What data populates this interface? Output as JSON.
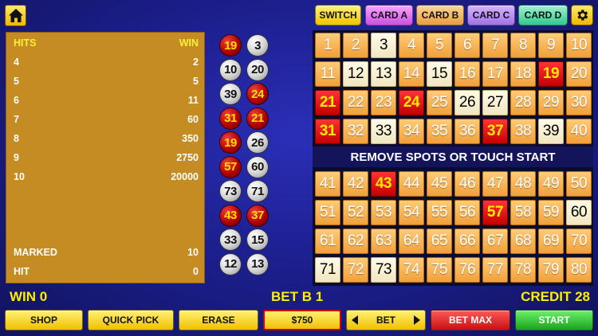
{
  "colors": {
    "background": "#1c1f8e",
    "paytable": "#c48c22",
    "highlight_text": "#ffee00",
    "number_cell": "#f0a03a",
    "marked_cell": "#fffbe7",
    "hit_cell": "#c40000"
  },
  "icons": {
    "home": "home-icon",
    "settings": "gear-icon"
  },
  "toolbar": {
    "switch_label": "SWITCH",
    "card_a": "CARD A",
    "card_b": "CARD B",
    "card_c": "CARD C",
    "card_d": "CARD D"
  },
  "paytable": {
    "hits_header": "HITS",
    "win_header": "WIN",
    "rows": [
      {
        "hits": "4",
        "win": "2"
      },
      {
        "hits": "5",
        "win": "5"
      },
      {
        "hits": "6",
        "win": "11"
      },
      {
        "hits": "7",
        "win": "60"
      },
      {
        "hits": "8",
        "win": "350"
      },
      {
        "hits": "9",
        "win": "2750"
      },
      {
        "hits": "10",
        "win": "20000"
      }
    ],
    "marked_label": "MARKED",
    "marked_value": "10",
    "hit_label": "HIT",
    "hit_value": "0"
  },
  "drawn_balls": [
    {
      "n": "19",
      "hit": true
    },
    {
      "n": "3",
      "hit": false
    },
    {
      "n": "10",
      "hit": false
    },
    {
      "n": "20",
      "hit": false
    },
    {
      "n": "39",
      "hit": false
    },
    {
      "n": "24",
      "hit": true
    },
    {
      "n": "31",
      "hit": true
    },
    {
      "n": "21",
      "hit": true
    },
    {
      "n": "19",
      "hit": true
    },
    {
      "n": "26",
      "hit": false
    },
    {
      "n": "57",
      "hit": true
    },
    {
      "n": "60",
      "hit": false
    },
    {
      "n": "73",
      "hit": false
    },
    {
      "n": "71",
      "hit": false
    },
    {
      "n": "43",
      "hit": true
    },
    {
      "n": "37",
      "hit": true
    },
    {
      "n": "33",
      "hit": false
    },
    {
      "n": "15",
      "hit": false
    },
    {
      "n": "12",
      "hit": false
    },
    {
      "n": "13",
      "hit": false
    }
  ],
  "board": {
    "message": "REMOVE SPOTS OR TOUCH START",
    "marked": [
      3,
      12,
      13,
      15,
      26,
      27,
      33,
      39,
      60,
      71,
      73
    ],
    "hits": [
      19,
      21,
      24,
      31,
      37,
      43,
      57
    ]
  },
  "status": {
    "win": "WIN 0",
    "bet": "BET B 1",
    "credit": "CREDIT 28"
  },
  "controls": {
    "shop": "SHOP",
    "quick_pick": "QUICK PICK",
    "erase": "ERASE",
    "denomination": "$750",
    "bet": "BET",
    "bet_max": "BET MAX",
    "start": "START"
  }
}
